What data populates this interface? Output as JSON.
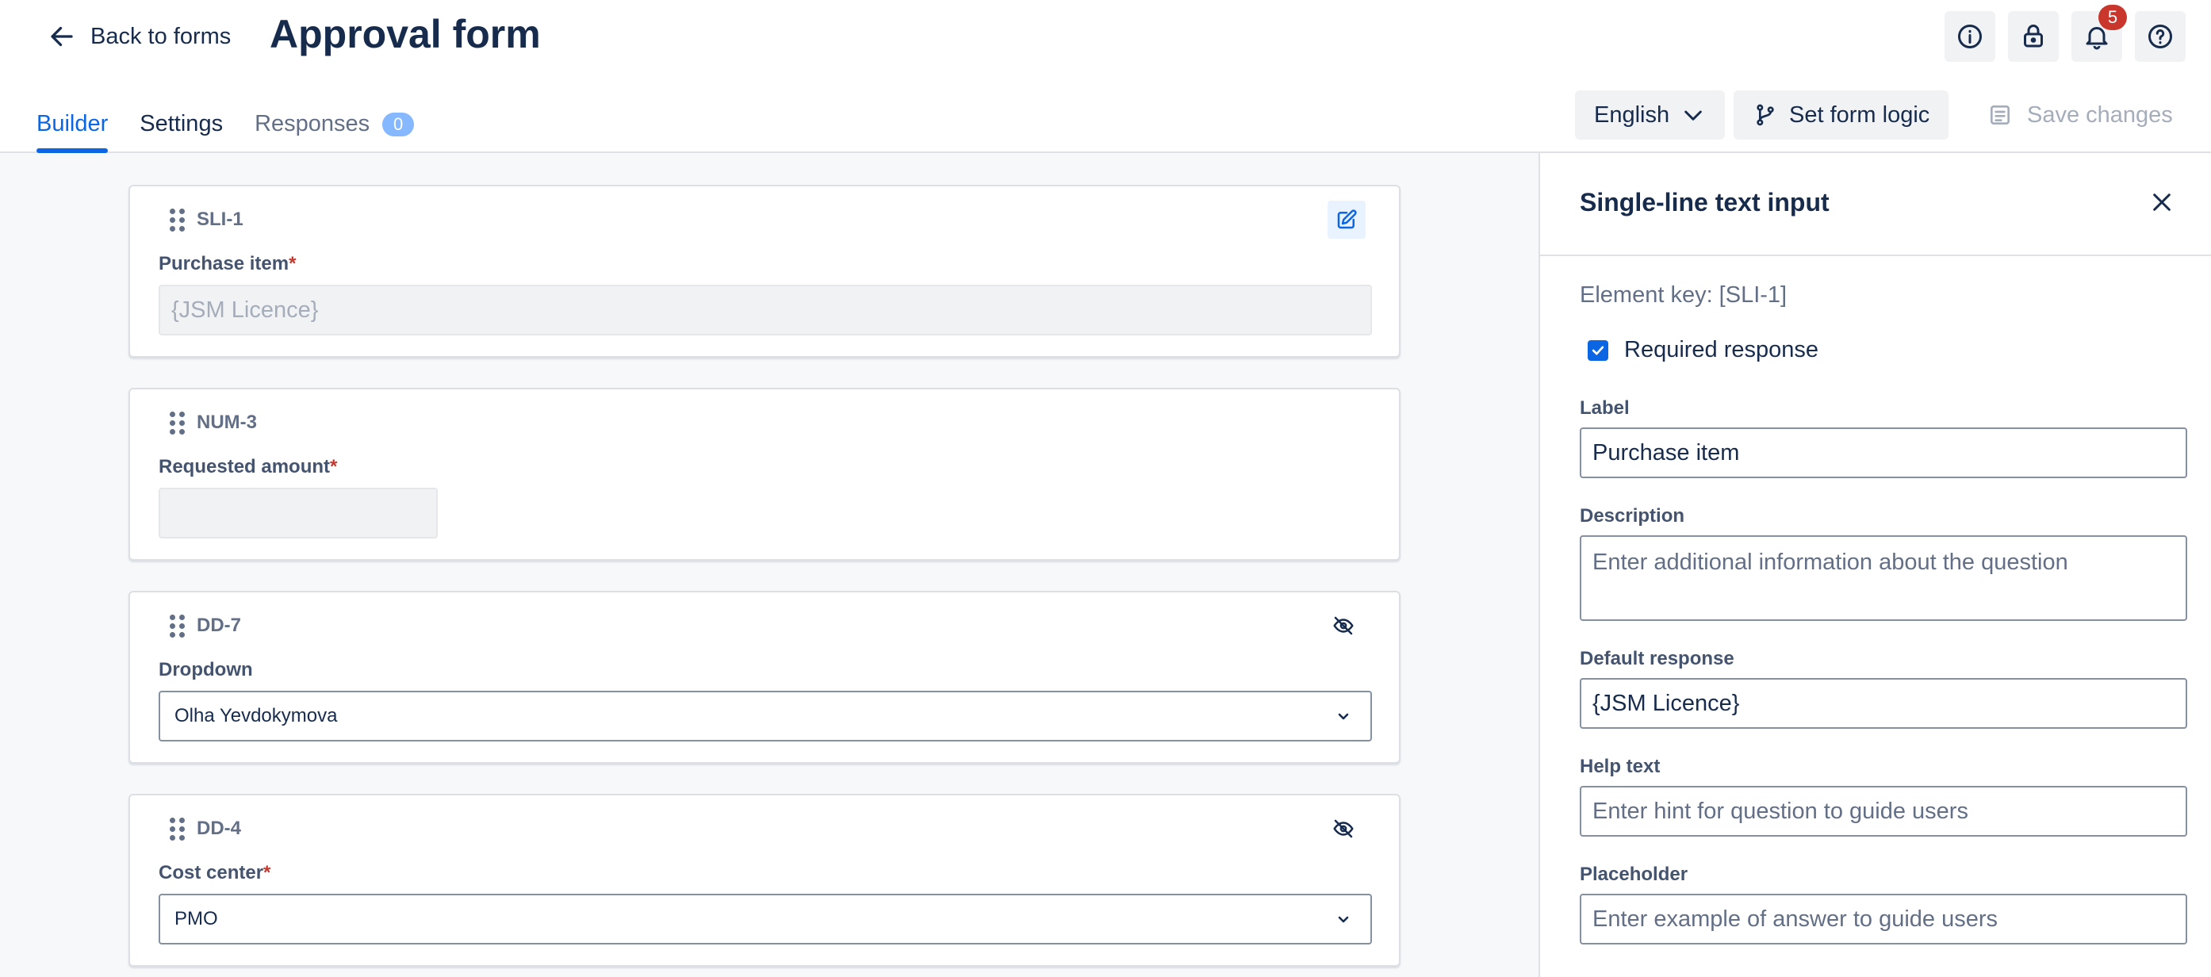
{
  "header": {
    "back_label": "Back to forms",
    "title": "Approval form",
    "notification_count": "5",
    "language_label": "English",
    "form_logic_label": "Set form logic",
    "save_label": "Save changes"
  },
  "tabs": [
    {
      "label": "Builder"
    },
    {
      "label": "Settings"
    },
    {
      "label": "Responses",
      "count": "0"
    }
  ],
  "cards": [
    {
      "key": "SLI-1",
      "label": "Purchase item",
      "required": "*",
      "value": "{JSM Licence}"
    },
    {
      "key": "NUM-3",
      "label": "Requested amount",
      "required": "*",
      "value": ""
    },
    {
      "key": "DD-7",
      "label": "Dropdown",
      "required": "",
      "value": "Olha Yevdokymova"
    },
    {
      "key": "DD-4",
      "label": "Cost center",
      "required": "*",
      "value": "PMO"
    }
  ],
  "panel": {
    "title": "Single-line text input",
    "element_key": "Element key: [SLI-1]",
    "required_label": "Required response",
    "label_label": "Label",
    "label_value": "Purchase item",
    "description_label": "Description",
    "description_placeholder": "Enter additional information about the question",
    "default_label": "Default response",
    "default_value": "{JSM Licence}",
    "help_label": "Help text",
    "help_placeholder": "Enter hint for question to guide users",
    "placeholder_label": "Placeholder",
    "placeholder_placeholder": "Enter example of answer to guide users"
  },
  "colors": {
    "accent": "#0c66e4",
    "required": "#c9372c",
    "badge": "#c9372c"
  },
  "icons": [
    "arrow-left-icon",
    "info-icon",
    "lock-icon",
    "bell-icon",
    "help-icon",
    "chevron-down-icon",
    "branch-icon",
    "save-icon",
    "drag-handle-icon",
    "edit-icon",
    "eye-off-icon",
    "close-icon",
    "check-icon"
  ]
}
